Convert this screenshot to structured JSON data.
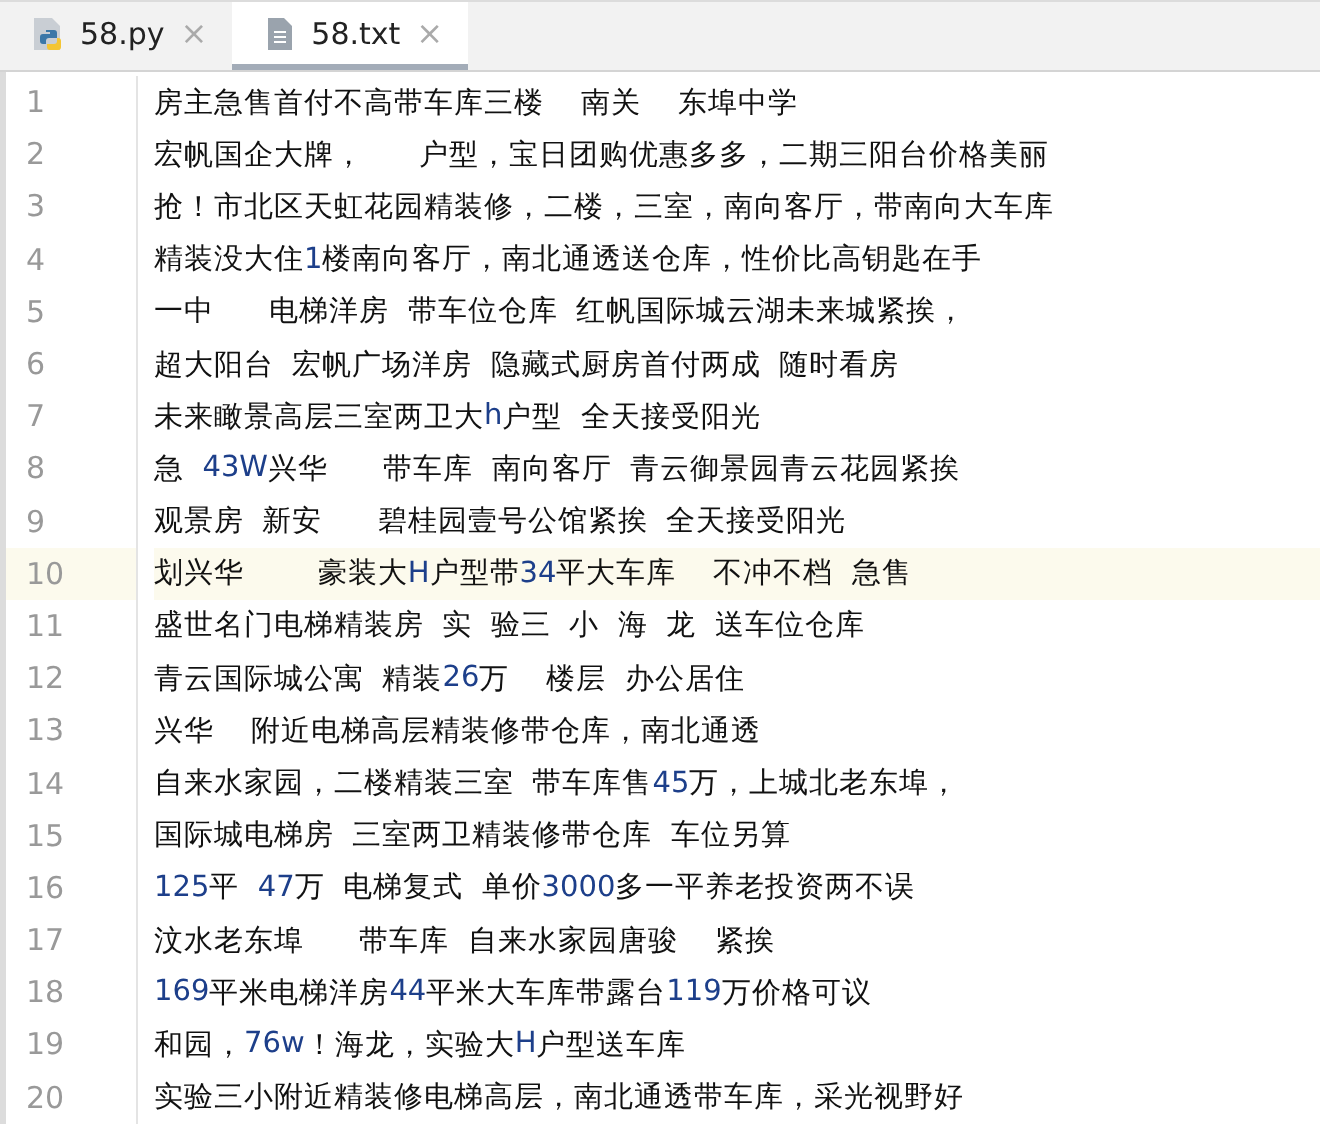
{
  "tabs": [
    {
      "label": "58.py",
      "kind": "python",
      "close": "×",
      "selected": false
    },
    {
      "label": "58.txt",
      "kind": "text",
      "close": "×",
      "selected": true
    }
  ],
  "editor": {
    "lines": [
      {
        "number": "1",
        "text": "房主急售首付不高带车库三楼    南关    东埠中学",
        "selected": false
      },
      {
        "number": "2",
        "text": "宏帆国企大牌，      户型，宝日团购优惠多多，二期三阳台价格美丽",
        "selected": false
      },
      {
        "number": "3",
        "text": "抢！市北区天虹花园精装修，二楼，三室，南向客厅，带南向大车库",
        "selected": false
      },
      {
        "number": "4",
        "text": "精装没大住1楼南向客厅，南北通透送仓库，性价比高钥匙在手",
        "selected": false
      },
      {
        "number": "5",
        "text": "一中      电梯洋房  带车位仓库  红帆国际城云湖未来城紧挨，",
        "selected": false
      },
      {
        "number": "6",
        "text": "超大阳台  宏帆广场洋房  隐藏式厨房首付两成  随时看房",
        "selected": false
      },
      {
        "number": "7",
        "text": "未来瞰景高层三室两卫大h户型  全天接受阳光",
        "selected": false
      },
      {
        "number": "8",
        "text": "急  43W兴华      带车库  南向客厅  青云御景园青云花园紧挨",
        "selected": false
      },
      {
        "number": "9",
        "text": "观景房  新安      碧桂园壹号公馆紧挨  全天接受阳光",
        "selected": false
      },
      {
        "number": "10",
        "text": "划兴华        豪装大H户型带34平大车库    不冲不档  急售",
        "selected": true
      },
      {
        "number": "11",
        "text": "盛世名门电梯精装房  实  验三  小  海  龙  送车位仓库",
        "selected": false
      },
      {
        "number": "12",
        "text": "青云国际城公寓  精装26万    楼层  办公居住",
        "selected": false
      },
      {
        "number": "13",
        "text": "兴华    附近电梯高层精装修带仓库，南北通透",
        "selected": false
      },
      {
        "number": "14",
        "text": "自来水家园，二楼精装三室  带车库售45万，上城北老东埠，",
        "selected": false
      },
      {
        "number": "15",
        "text": "国际城电梯房  三室两卫精装修带仓库  车位另算",
        "selected": false
      },
      {
        "number": "16",
        "text": "125平  47万  电梯复式  单价3000多一平养老投资两不误",
        "selected": false
      },
      {
        "number": "17",
        "text": "汶水老东埠      带车库  自来水家园唐骏    紧挨",
        "selected": false
      },
      {
        "number": "18",
        "text": "169平米电梯洋房44平米大车库带露台119万价格可议",
        "selected": false
      },
      {
        "number": "19",
        "text": "和园，76w！海龙，实验大H户型送车库",
        "selected": false
      },
      {
        "number": "20",
        "text": "实验三小附近精装修电梯高层，南北通透带车库，采光视野好",
        "selected": false
      }
    ]
  }
}
